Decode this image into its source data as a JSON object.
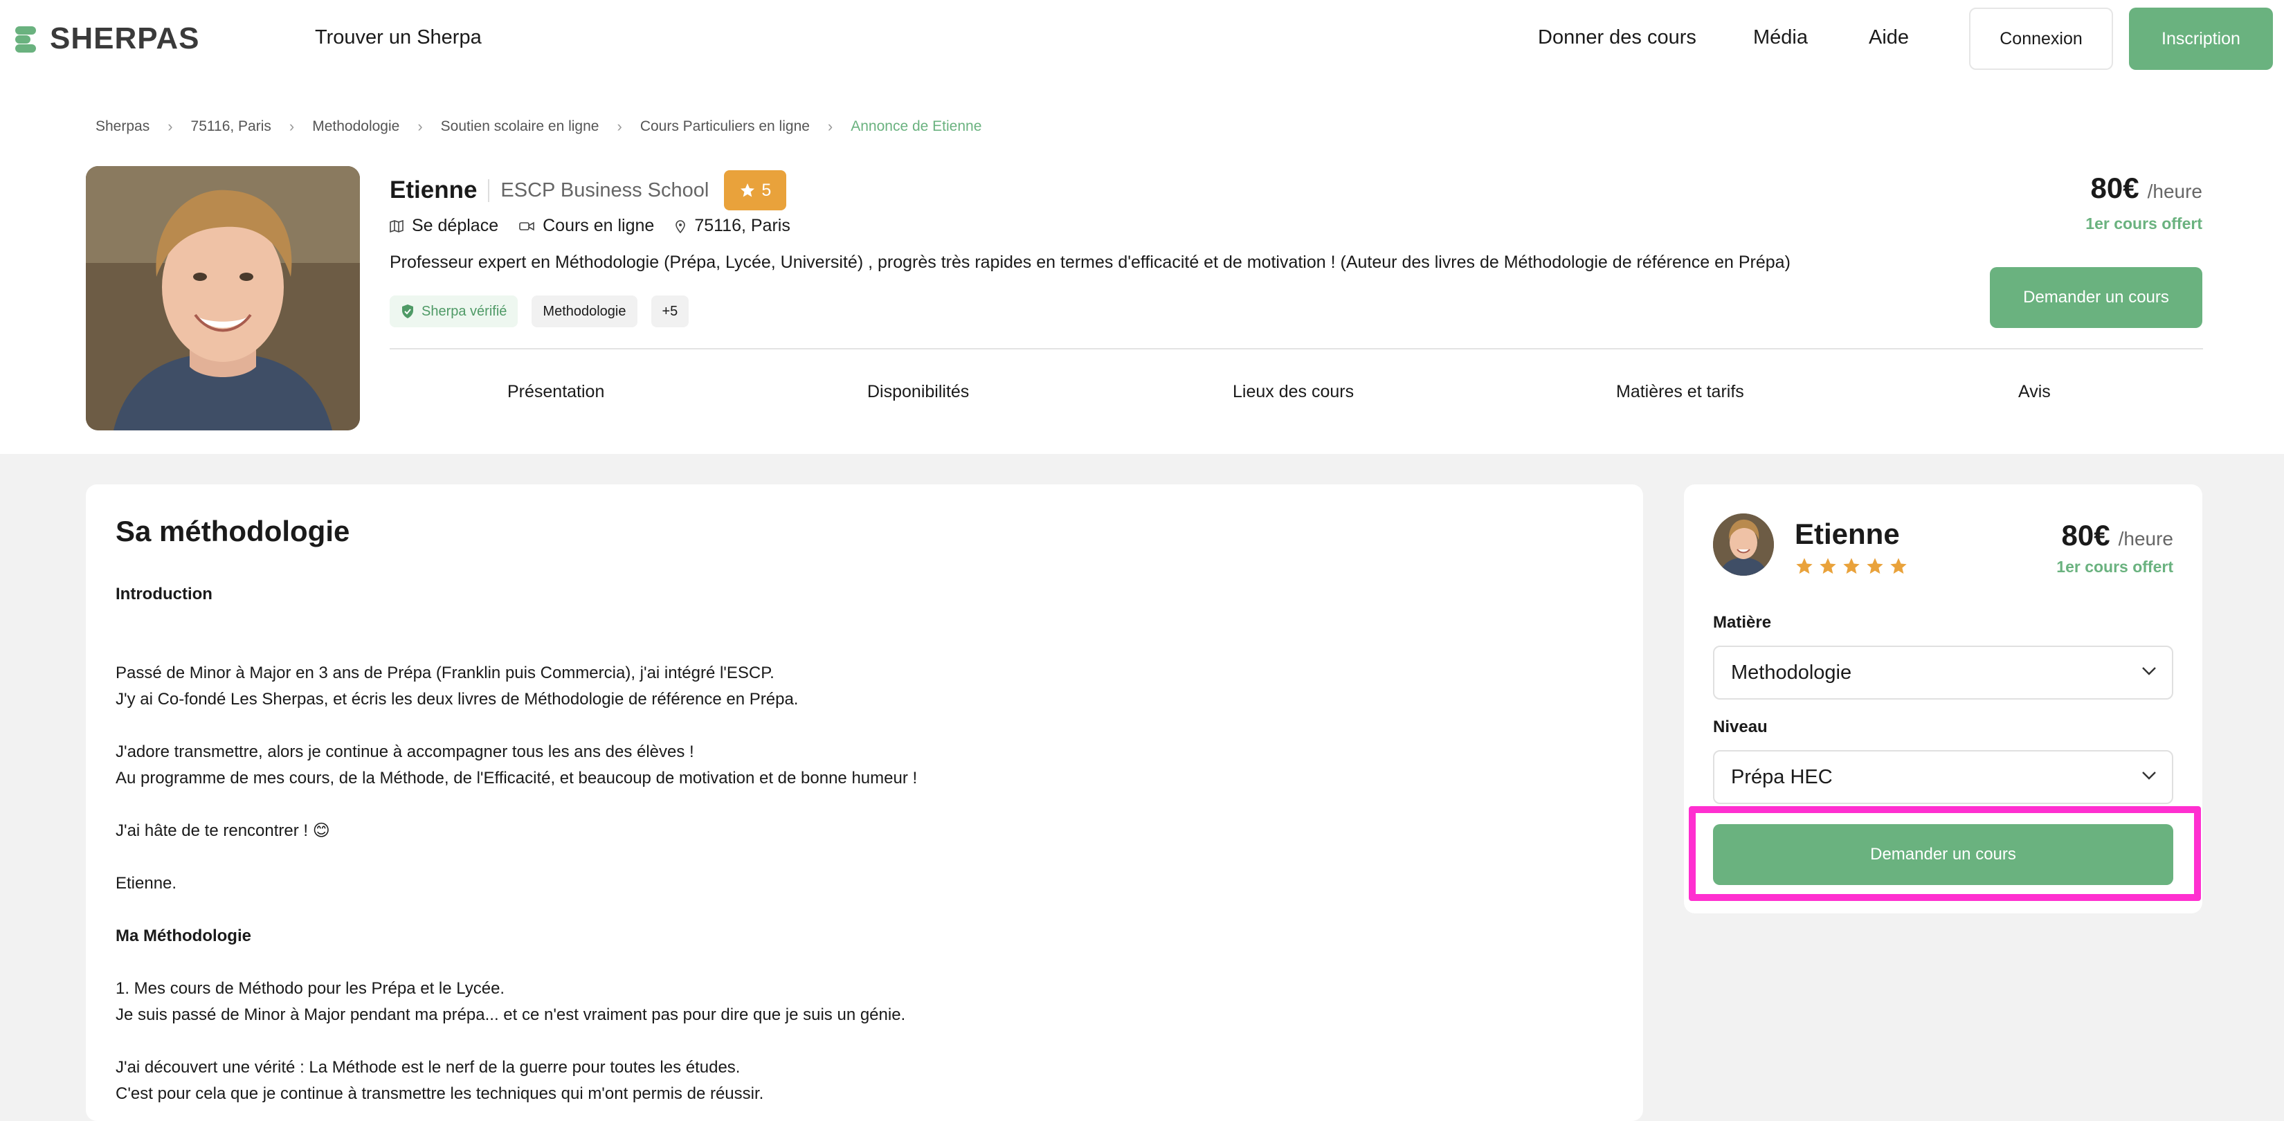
{
  "nav": {
    "logo_text": "SHERPAS",
    "find_label": "Trouver un Sherpa",
    "links": [
      "Donner des cours",
      "Média",
      "Aide"
    ],
    "login_label": "Connexion",
    "signup_label": "Inscription",
    "brand_color": "#6ab27f"
  },
  "breadcrumb": [
    "Sherpas",
    "75116, Paris",
    "Methodologie",
    "Soutien scolaire en ligne",
    "Cours Particuliers en ligne",
    "Annonce de Etienne"
  ],
  "profile": {
    "name": "Etienne",
    "school": "ESCP Business School",
    "rating": "5",
    "meta": [
      "Se déplace",
      "Cours en ligne",
      "75116, Paris"
    ],
    "tagline": "Professeur expert en Méthodologie (Prépa, Lycée, Université) , progrès très rapides en termes d'efficacité et de motivation ! (Auteur des livres de Méthodologie de référence en Prépa)",
    "verified_label": "Sherpa vérifié",
    "subject_tag": "Methodologie",
    "more_tag": "+5",
    "price": "80€",
    "price_unit": "/heure",
    "offer": "1er cours offert",
    "cta": "Demander un cours"
  },
  "tabs": [
    "Présentation",
    "Disponibilités",
    "Lieux des cours",
    "Matières et tarifs",
    "Avis"
  ],
  "content": {
    "title": "Sa méthodologie",
    "intro_heading": "Introduction",
    "lines_a": [
      "Passé de Minor à Major en 3 ans de Prépa (Franklin puis Commercia), j'ai intégré l'ESCP.",
      "J'y ai Co-fondé Les Sherpas, et écris les deux livres de Méthodologie de référence en Prépa."
    ],
    "lines_b": [
      "J'adore transmettre, alors je continue à accompagner tous les ans des élèves !",
      "Au programme de mes cours, de la Méthode, de l'Efficacité, et beaucoup de motivation et de bonne humeur !"
    ],
    "line_c": "J'ai hâte de te rencontrer ! 😊",
    "line_d": "Etienne.",
    "method_heading": "Ma Méthodologie",
    "lines_e": [
      "1. Mes cours de Méthodo pour les Prépa et le Lycée.",
      "Je suis passé de Minor à Major pendant ma prépa... et ce n'est vraiment pas pour dire que je suis un génie."
    ],
    "lines_f": [
      "J'ai découvert une vérité : La Méthode est le nerf de la guerre pour toutes les études.",
      "C'est pour cela que je continue à transmettre les techniques qui m'ont permis de réussir."
    ]
  },
  "sidebar": {
    "name": "Etienne",
    "stars": 5,
    "price": "80€",
    "price_unit": "/heure",
    "offer": "1er cours offert",
    "subject_label": "Matière",
    "subject_value": "Methodologie",
    "level_label": "Niveau",
    "level_value": "Prépa HEC",
    "cta": "Demander un cours",
    "highlight_color": "#ff2fd0"
  }
}
